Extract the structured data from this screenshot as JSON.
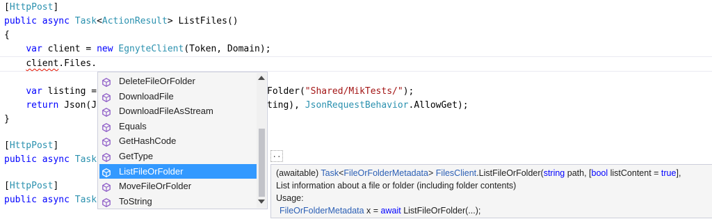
{
  "code": {
    "l1_attr": "HttpPost",
    "l2_public": "public",
    "l2_async": "async",
    "l2_task": "Task",
    "l2_actionresult": "ActionResult",
    "l2_method": "ListFiles",
    "l4_var": "var",
    "l4_client": "client",
    "l4_new": "new",
    "l4_type": "EgnyteClient",
    "l4_args": "(Token, Domain);",
    "l5_client": "client",
    "l5_rest": ".Files.",
    "l7_var": "var",
    "l7_listing": "listing =",
    "l7_right": "Folder(",
    "l7_string": "\"Shared/MikTests/\"",
    "l7_end": ");",
    "l8_return": "return",
    "l8_json": "Json(",
    "l8_right_a": "ting), ",
    "l8_type": "JsonRequestBehavior",
    "l8_right_b": ".AllowGet);",
    "l9_brace": "}",
    "l11_attr": "HttpPost",
    "l12_public": "public",
    "l12_async": "async",
    "l12_task": "Task",
    "l14_attr": "HttpPost",
    "l15_public": "public",
    "l15_async": "async",
    "l15_task": "Task",
    "param_hint": ".."
  },
  "completion": {
    "items": [
      {
        "label": "DeleteFileOrFolder",
        "icon": "method-icon"
      },
      {
        "label": "DownloadFile",
        "icon": "method-icon"
      },
      {
        "label": "DownloadFileAsStream",
        "icon": "method-icon"
      },
      {
        "label": "Equals",
        "icon": "method-icon"
      },
      {
        "label": "GetHashCode",
        "icon": "method-icon"
      },
      {
        "label": "GetType",
        "icon": "method-icon"
      },
      {
        "label": "ListFileOrFolder",
        "icon": "method-icon",
        "selected": true
      },
      {
        "label": "MoveFileOrFolder",
        "icon": "method-icon"
      },
      {
        "label": "ToString",
        "icon": "method-icon"
      }
    ],
    "selection_color": "#3399ff",
    "icon_color": "#8e5cc7"
  },
  "tooltip": {
    "line1": {
      "awaitable": "(awaitable)",
      "task": "Task",
      "lt": "<",
      "meta_type": "FileOrFolderMetadata",
      "gt": ">",
      "class": "FilesClient",
      "dot_method": ".ListFileOrFolder(",
      "string_kw": "string",
      "path": " path, [",
      "bool_kw": "bool",
      "listcontent": " listContent = ",
      "true_kw": "true",
      "end": "],"
    },
    "line2": "List information about a file or folder (including folder contents)",
    "line3": "Usage:",
    "line4": {
      "type": "FileOrFolderMetadata",
      "x": " x = ",
      "await": "await",
      "call": " ListFileOrFolder(...);"
    }
  }
}
